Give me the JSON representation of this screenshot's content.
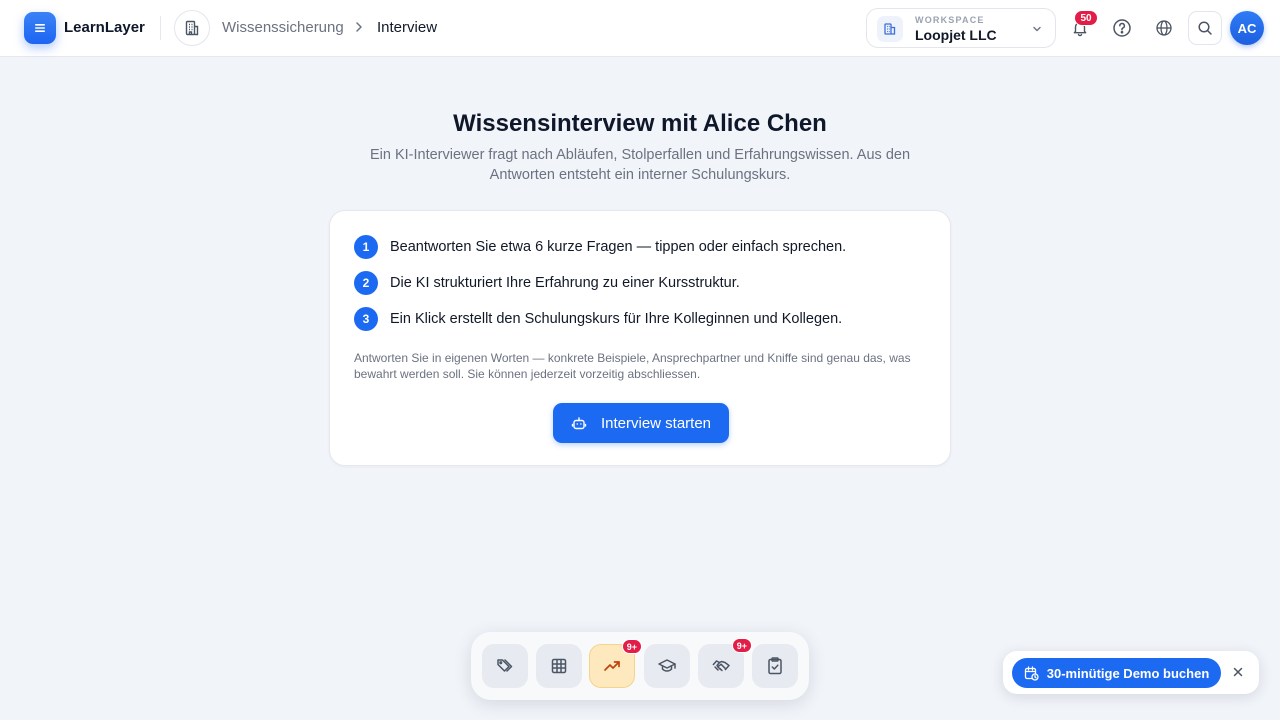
{
  "header": {
    "brand": "LearnLayer",
    "breadcrumb": [
      "Wissenssicherung",
      "Interview"
    ],
    "workspace_label": "WORKSPACE",
    "workspace_name": "Loopjet LLC",
    "notifications_count": "50",
    "avatar_initials": "AC"
  },
  "main": {
    "title": "Wissensinterview mit Alice Chen",
    "subtitle": "Ein KI-Interviewer fragt nach Abläufen, Stolperfallen und Erfahrungswissen. Aus den Antworten entsteht ein interner Schulungskurs.",
    "steps": [
      {
        "num": "1",
        "text": "Beantworten Sie etwa 6 kurze Fragen — tippen oder einfach sprechen."
      },
      {
        "num": "2",
        "text": "Die KI strukturiert Ihre Erfahrung zu einer Kursstruktur."
      },
      {
        "num": "3",
        "text": "Ein Klick erstellt den Schulungskurs für Ihre Kolleginnen und Kollegen."
      }
    ],
    "note": "Antworten Sie in eigenen Worten — konkrete Beispiele, Ansprechpartner und Kniffe sind genau das, was bewahrt werden soll. Sie können jederzeit vorzeitig abschliessen.",
    "start_button": "Interview starten"
  },
  "dock": {
    "items": [
      {
        "icon": "tags-icon"
      },
      {
        "icon": "grid-icon"
      },
      {
        "icon": "trending-up-icon",
        "badge": "9+",
        "active": true
      },
      {
        "icon": "graduation-cap-icon"
      },
      {
        "icon": "handshake-icon",
        "badge": "9+"
      },
      {
        "icon": "clipboard-check-icon"
      }
    ]
  },
  "demo": {
    "label": "30-minütige Demo buchen"
  },
  "colors": {
    "accent": "#1d6af2",
    "badge": "#e11d48",
    "background": "#f1f4f9"
  }
}
